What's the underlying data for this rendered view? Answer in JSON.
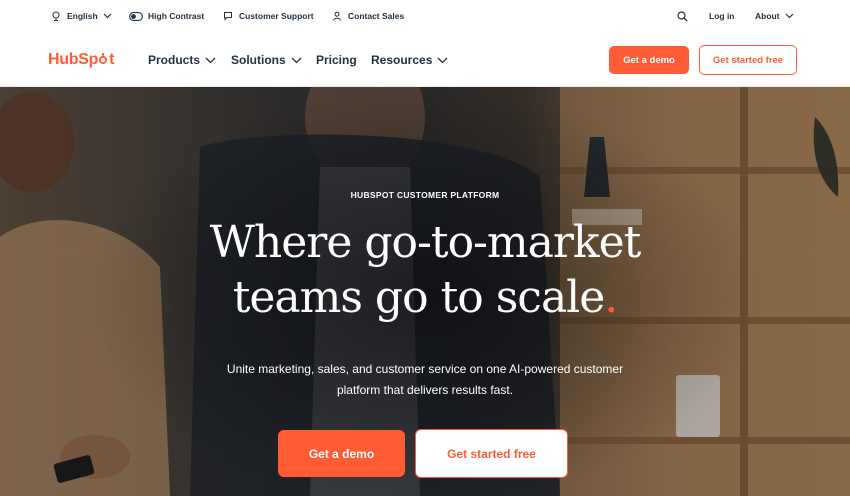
{
  "utility_bar": {
    "language": "English",
    "high_contrast": "High Contrast",
    "customer_support": "Customer Support",
    "contact_sales": "Contact Sales",
    "login": "Log in",
    "about": "About"
  },
  "nav": {
    "logo_text": [
      "Hub",
      "Sp",
      "t"
    ],
    "items": [
      {
        "label": "Products",
        "has_dropdown": true
      },
      {
        "label": "Solutions",
        "has_dropdown": true
      },
      {
        "label": "Pricing",
        "has_dropdown": false
      },
      {
        "label": "Resources",
        "has_dropdown": true
      }
    ],
    "demo_button": "Get a demo",
    "free_button": "Get started free"
  },
  "hero": {
    "eyebrow": "HUBSPOT CUSTOMER PLATFORM",
    "headline_line1": "Where go-to-market",
    "headline_line2": "teams go to scale",
    "headline_dot": ".",
    "subhead": "Unite marketing, sales, and customer service on one AI-powered customer platform that delivers results fast.",
    "demo_button": "Get a demo",
    "free_button": "Get started free"
  },
  "colors": {
    "brand_orange": "#ff5c35",
    "text_dark": "#213343"
  },
  "icons": [
    "globe-icon",
    "toggle-icon",
    "chat-icon",
    "person-icon",
    "search-icon",
    "chevron-down-icon"
  ]
}
